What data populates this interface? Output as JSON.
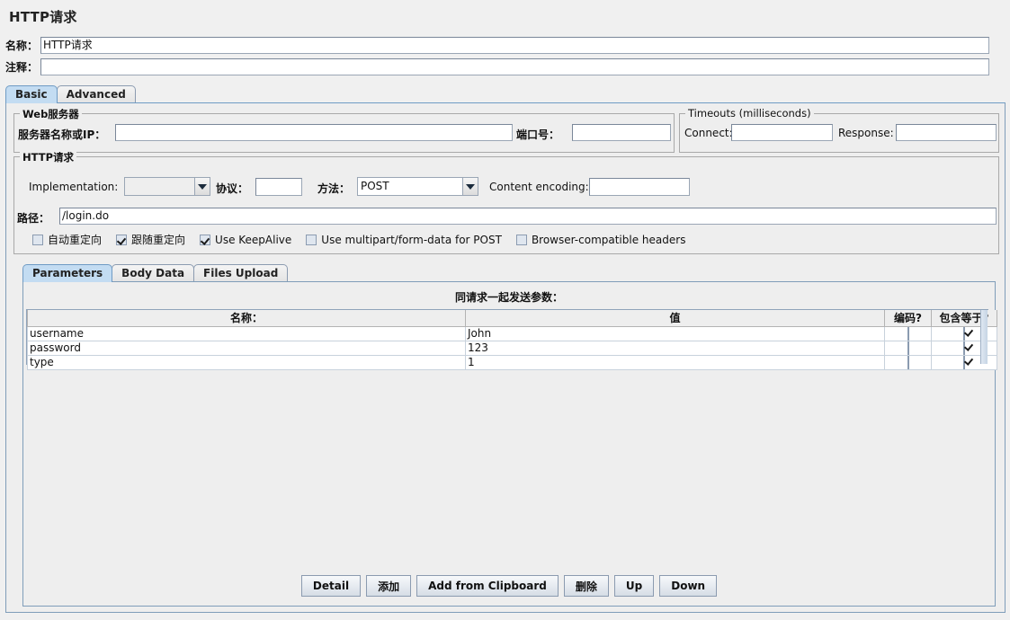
{
  "window": {
    "title": "HTTP请求"
  },
  "header": {
    "name_label": "名称：",
    "name_value": "HTTP请求",
    "comment_label": "注释：",
    "comment_value": ""
  },
  "tabs": [
    {
      "label": "Basic",
      "selected": true
    },
    {
      "label": "Advanced",
      "selected": false
    }
  ],
  "webserver": {
    "group_title": "Web服务器",
    "server_label": "服务器名称或IP：",
    "server_value": "",
    "port_label": "端口号：",
    "port_value": ""
  },
  "timeouts": {
    "group_title": "Timeouts (milliseconds)",
    "connect_label": "Connect:",
    "connect_value": "",
    "response_label": "Response:",
    "response_value": ""
  },
  "httprequest": {
    "group_title": "HTTP请求",
    "implementation_label": "Implementation:",
    "implementation_value": "",
    "protocol_label": "协议：",
    "protocol_value": "",
    "method_label": "方法：",
    "method_value": "POST",
    "content_encoding_label": "Content encoding:",
    "content_encoding_value": "",
    "path_label": "路径：",
    "path_value": "/login.do",
    "checkboxes": [
      {
        "label": "自动重定向",
        "checked": false
      },
      {
        "label": "跟随重定向",
        "checked": true
      },
      {
        "label": "Use KeepAlive",
        "checked": true
      },
      {
        "label": "Use multipart/form-data for POST",
        "checked": false
      },
      {
        "label": "Browser-compatible headers",
        "checked": false
      }
    ]
  },
  "inner_tabs": [
    {
      "label": "Parameters",
      "selected": true
    },
    {
      "label": "Body Data",
      "selected": false
    },
    {
      "label": "Files Upload",
      "selected": false
    }
  ],
  "parameters": {
    "heading": "同请求一起发送参数：",
    "columns": [
      "名称：",
      "值",
      "编码?",
      "包含等于?"
    ],
    "rows": [
      {
        "name": "username",
        "value": "John",
        "encode": false,
        "include_equals": true
      },
      {
        "name": "password",
        "value": "123",
        "encode": false,
        "include_equals": true
      },
      {
        "name": "type",
        "value": "1",
        "encode": false,
        "include_equals": true
      }
    ],
    "buttons": [
      {
        "label": "Detail"
      },
      {
        "label": "添加"
      },
      {
        "label": "Add from Clipboard"
      },
      {
        "label": "删除"
      },
      {
        "label": "Up"
      },
      {
        "label": "Down"
      }
    ]
  },
  "colors": {
    "panel_bg": "#eeeeee",
    "selected_tab": "#c3dcf2",
    "border": "#7f9db9"
  }
}
